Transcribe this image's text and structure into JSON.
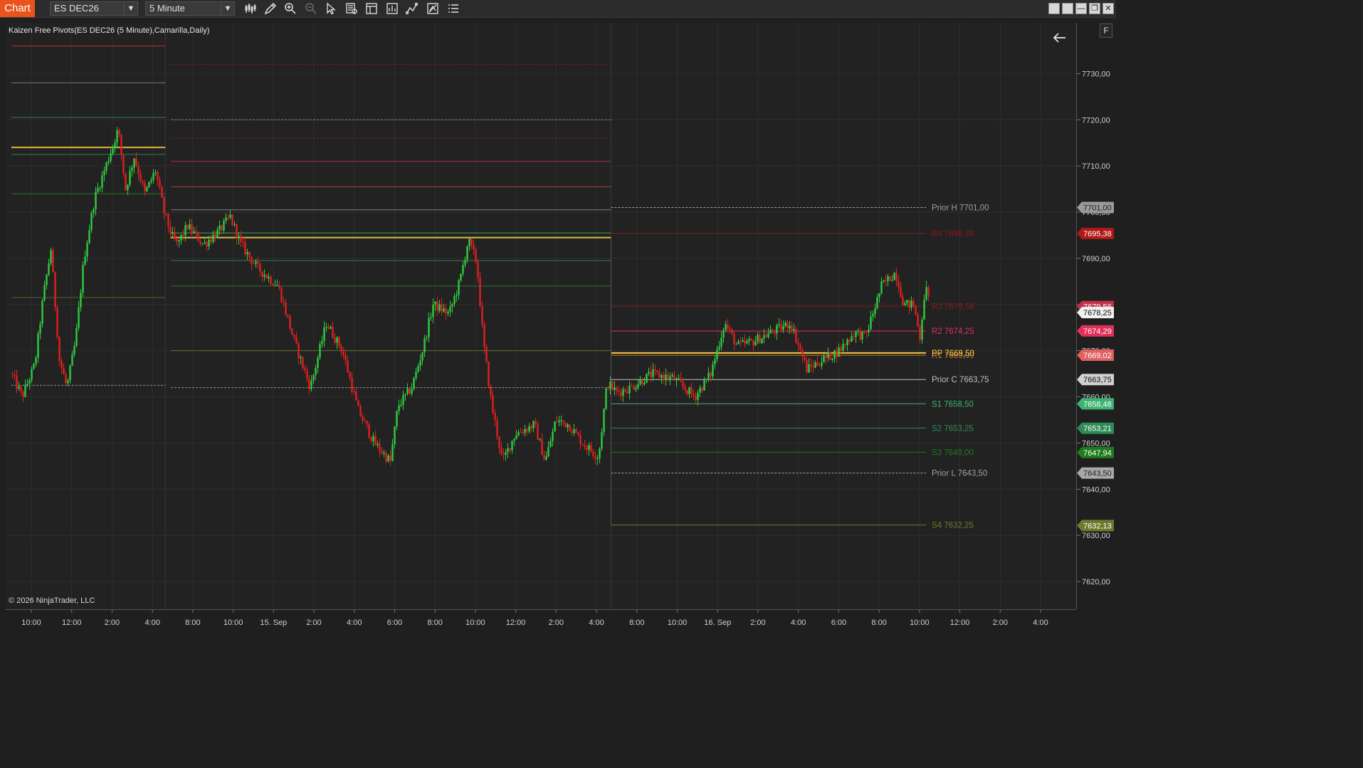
{
  "toolbar": {
    "tab_label": "Chart",
    "instrument": "ES DEC26",
    "interval": "5 Minute",
    "tool_icons": [
      "bar-type-icon",
      "draw-pen-icon",
      "zoom-in-icon",
      "zoom-out-icon",
      "pointer-icon",
      "data-box-icon",
      "properties-icon",
      "strategies-icon",
      "indicators-icon",
      "templates-icon",
      "more-menu-icon"
    ]
  },
  "chart": {
    "indicator_label": "Kaizen Free Pivots(ES DEC26 (5 Minute),Camarilla,Daily)",
    "copyright": "© 2026 NinjaTrader, LLC",
    "f_button": "F"
  },
  "chart_data": {
    "type": "candlestick",
    "y_axis": {
      "ylim": [
        7614,
        7741
      ],
      "ticks": [
        "7730,00",
        "7720,00",
        "7710,00",
        "7700,00",
        "7690,00",
        "7680,00",
        "7670,00",
        "7660,00",
        "7650,00",
        "7640,00",
        "7630,00",
        "7620,00"
      ],
      "tick_values": [
        7730,
        7720,
        7710,
        7700,
        7690,
        7680,
        7670,
        7660,
        7650,
        7640,
        7630,
        7620
      ]
    },
    "x_axis": {
      "ticks": [
        "10:00",
        "12:00",
        "2:00",
        "4:00",
        "8:00",
        "10:00",
        "15. Sep",
        "2:00",
        "4:00",
        "6:00",
        "8:00",
        "10:00",
        "12:00",
        "2:00",
        "4:00",
        "8:00",
        "10:00",
        "16. Sep",
        "2:00",
        "4:00",
        "6:00",
        "8:00",
        "10:00",
        "12:00",
        "2:00",
        "4:00"
      ]
    },
    "session_breaks": [
      0.1495,
      0.567
    ],
    "price_path_waypoints": [
      [
        0.0,
        7665
      ],
      [
        0.01,
        7660
      ],
      [
        0.022,
        7667
      ],
      [
        0.03,
        7682
      ],
      [
        0.037,
        7692
      ],
      [
        0.045,
        7668
      ],
      [
        0.052,
        7662
      ],
      [
        0.06,
        7672
      ],
      [
        0.068,
        7690
      ],
      [
        0.078,
        7703
      ],
      [
        0.09,
        7711
      ],
      [
        0.1,
        7718
      ],
      [
        0.107,
        7705
      ],
      [
        0.115,
        7712
      ],
      [
        0.125,
        7704
      ],
      [
        0.135,
        7709
      ],
      [
        0.143,
        7700
      ],
      [
        0.15,
        7695
      ],
      [
        0.155,
        7693
      ],
      [
        0.165,
        7697
      ],
      [
        0.18,
        7693
      ],
      [
        0.195,
        7696
      ],
      [
        0.205,
        7699
      ],
      [
        0.215,
        7693
      ],
      [
        0.23,
        7688
      ],
      [
        0.25,
        7684
      ],
      [
        0.265,
        7672
      ],
      [
        0.28,
        7662
      ],
      [
        0.295,
        7676
      ],
      [
        0.31,
        7670
      ],
      [
        0.325,
        7657
      ],
      [
        0.34,
        7650
      ],
      [
        0.355,
        7646
      ],
      [
        0.362,
        7658
      ],
      [
        0.375,
        7662
      ],
      [
        0.385,
        7670
      ],
      [
        0.395,
        7680
      ],
      [
        0.41,
        7678
      ],
      [
        0.42,
        7685
      ],
      [
        0.428,
        7694
      ],
      [
        0.436,
        7689
      ],
      [
        0.442,
        7672
      ],
      [
        0.45,
        7658
      ],
      [
        0.46,
        7646
      ],
      [
        0.472,
        7652
      ],
      [
        0.49,
        7654
      ],
      [
        0.5,
        7646
      ],
      [
        0.51,
        7655
      ],
      [
        0.522,
        7654
      ],
      [
        0.535,
        7650
      ],
      [
        0.55,
        7647
      ],
      [
        0.558,
        7663
      ],
      [
        0.567,
        7661
      ],
      [
        0.58,
        7662
      ],
      [
        0.6,
        7665
      ],
      [
        0.62,
        7664
      ],
      [
        0.64,
        7660
      ],
      [
        0.655,
        7665
      ],
      [
        0.668,
        7676
      ],
      [
        0.68,
        7671
      ],
      [
        0.695,
        7672
      ],
      [
        0.712,
        7674
      ],
      [
        0.73,
        7676
      ],
      [
        0.745,
        7666
      ],
      [
        0.76,
        7668
      ],
      [
        0.775,
        7670
      ],
      [
        0.79,
        7674
      ],
      [
        0.8,
        7673
      ],
      [
        0.815,
        7684
      ],
      [
        0.828,
        7687
      ],
      [
        0.836,
        7680
      ],
      [
        0.845,
        7680
      ],
      [
        0.851,
        7673
      ],
      [
        0.856,
        7684
      ],
      [
        0.86,
        7680
      ]
    ],
    "pivot_levels": {
      "prior_sessions": [
        {
          "start": 0.0,
          "end": 0.1495,
          "levels": [
            {
              "value": 7736,
              "color": "#c03232"
            },
            {
              "value": 7728,
              "color": "#808080"
            },
            {
              "value": 7720.5,
              "color": "#2e8b57"
            },
            {
              "value": 7714,
              "color": "#f5c842",
              "thick": true
            },
            {
              "value": 7712.5,
              "color": "#2e8b57"
            },
            {
              "value": 7704,
              "color": "#2e7d32"
            },
            {
              "value": 7681.5,
              "color": "#556b2f"
            },
            {
              "value": 7662.5,
              "color": "#a0a0a0",
              "dashed": true
            }
          ]
        },
        {
          "start": 0.1495,
          "end": 0.567,
          "levels": [
            {
              "value": 7732,
              "color": "#8b1a1a",
              "dashed": true
            },
            {
              "value": 7720,
              "color": "#909090",
              "dashed": true
            },
            {
              "value": 7716,
              "color": "#8b1a1a",
              "dashed": true
            },
            {
              "value": 7711,
              "color": "#c0304a"
            },
            {
              "value": 7705.5,
              "color": "#c04040"
            },
            {
              "value": 7700.5,
              "color": "#8a8a8a"
            },
            {
              "value": 7695.5,
              "color": "#3cb371"
            },
            {
              "value": 7694.5,
              "color": "#f5c842",
              "thick": true
            },
            {
              "value": 7689.5,
              "color": "#2e8b57"
            },
            {
              "value": 7684,
              "color": "#2e7d32"
            },
            {
              "value": 7670,
              "color": "#6b7b2f"
            },
            {
              "value": 7662,
              "color": "#a0a0a0",
              "dashed": true
            }
          ]
        }
      ],
      "current_session_start": 0.567,
      "current": [
        {
          "label": "Prior H",
          "value": "7701,00",
          "color": "#a0a0a0",
          "dashed": true
        },
        {
          "label": "R4",
          "value": "7695,38",
          "color": "#8b1a1a"
        },
        {
          "label": "R3",
          "value": "7679,56",
          "color": "#8b1a1a"
        },
        {
          "label": "R2",
          "value": "7674,25",
          "color": "#e0305a"
        },
        {
          "label": "R1",
          "value": "7669,00",
          "color": "#c87832"
        },
        {
          "label": "PP",
          "value": "7669,50",
          "color": "#f5c842",
          "thick": true
        },
        {
          "label": "Prior C",
          "value": "7663,75",
          "color": "#bfbfbf"
        },
        {
          "label": "S1",
          "value": "7658,50",
          "color": "#3cb371"
        },
        {
          "label": "S2",
          "value": "7653,25",
          "color": "#2e8b57"
        },
        {
          "label": "S3",
          "value": "7648,00",
          "color": "#1e7b1e"
        },
        {
          "label": "Prior L",
          "value": "7643,50",
          "color": "#a0a0a0",
          "dashed": true
        },
        {
          "label": "S4",
          "value": "7632,25",
          "color": "#6b7b2f"
        }
      ]
    },
    "price_markers": [
      {
        "value": "7701,00",
        "price": 7701.0,
        "bg": "#9a9a9a",
        "fg": "#222"
      },
      {
        "value": "7695,38",
        "price": 7695.38,
        "bg": "#b01818",
        "fg": "#fff"
      },
      {
        "value": "7679,56",
        "price": 7679.56,
        "bg": "#c0304a",
        "fg": "#fff"
      },
      {
        "value": "7678,25",
        "price": 7678.25,
        "bg": "#f0f0f0",
        "fg": "#111"
      },
      {
        "value": "7674,29",
        "price": 7674.29,
        "bg": "#e0305a",
        "fg": "#fff"
      },
      {
        "value": "7669,02",
        "price": 7669.02,
        "bg": "#e06060",
        "fg": "#fff"
      },
      {
        "value": "7663,75",
        "price": 7663.75,
        "bg": "#d0d0d0",
        "fg": "#111"
      },
      {
        "value": "7658,48",
        "price": 7658.48,
        "bg": "#3cb371",
        "fg": "#fff"
      },
      {
        "value": "7653,21",
        "price": 7653.21,
        "bg": "#2e8b57",
        "fg": "#fff"
      },
      {
        "value": "7647,94",
        "price": 7647.94,
        "bg": "#1e7b1e",
        "fg": "#fff"
      },
      {
        "value": "7643,50",
        "price": 7643.5,
        "bg": "#a8a8a8",
        "fg": "#222"
      },
      {
        "value": "7632,13",
        "price": 7632.13,
        "bg": "#6b7b2f",
        "fg": "#fff"
      }
    ],
    "colors": {
      "up": "#2ecc40",
      "down": "#e02020",
      "grid": "#2e2e2e"
    }
  },
  "window_buttons": [
    "tile-icon",
    "tile-icon",
    "minimize-icon",
    "restore-icon",
    "close-icon"
  ]
}
